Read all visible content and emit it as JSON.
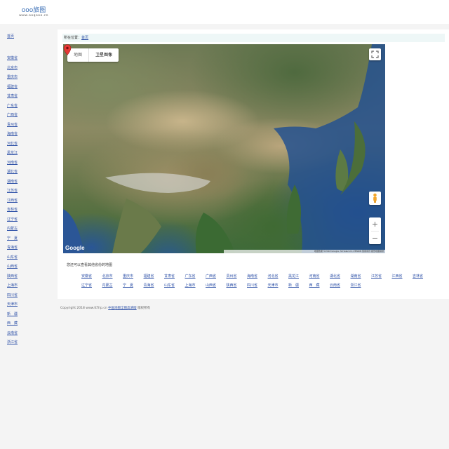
{
  "header": {
    "logo_top": "ooo旅图",
    "logo_bottom": "www.ooqooo.cn"
  },
  "sidebar": {
    "home": "首页",
    "items": [
      "安徽省",
      "北京市",
      "重庆市",
      "福建省",
      "甘肃省",
      "广东省",
      "广西省",
      "贵州省",
      "海南省",
      "河北省",
      "黑龙江",
      "河南省",
      "湖北省",
      "湖南省",
      "江苏省",
      "江西省",
      "吉林省",
      "辽宁省",
      "内蒙古",
      "宁　夏",
      "青海省",
      "山东省",
      "山西省",
      "陕西省",
      "上海市",
      "四川省",
      "天津市",
      "新　疆",
      "西　藏",
      "云南省",
      "浙江省"
    ]
  },
  "location": {
    "label": "所在位置：",
    "link": "首页"
  },
  "map": {
    "tab_map": "地图",
    "tab_satellite": "卫星图像",
    "zoom_in": "+",
    "zoom_out": "−",
    "google": "Google",
    "footer": "地图数据 ©2018 Google, SK telecom, ZENRIN  使用条款  报告地图错误"
  },
  "provinces_title": "您还可以查看其他省份的地图",
  "provinces": [
    "安徽省",
    "北京市",
    "重庆市",
    "福建省",
    "甘肃省",
    "广东省",
    "广西省",
    "贵州省",
    "海南省",
    "河北省",
    "黑龙江",
    "河南省",
    "湖北省",
    "湖南省",
    "江苏省",
    "江西省",
    "吉林省",
    "辽宁省",
    "内蒙古",
    "宁　夏",
    "青海省",
    "山东省",
    "上海市",
    "山西省",
    "陕西省",
    "四川省",
    "天津市",
    "新　疆",
    "西　藏",
    "云南省",
    "浙江省"
  ],
  "copyright": {
    "prefix": "Copyright 2018 www.ttTrip.cn",
    "link": "中国地图全图高清版",
    "suffix": "版权所有"
  },
  "colors": {
    "link": "#2f52a8",
    "marker": "#e53935"
  }
}
